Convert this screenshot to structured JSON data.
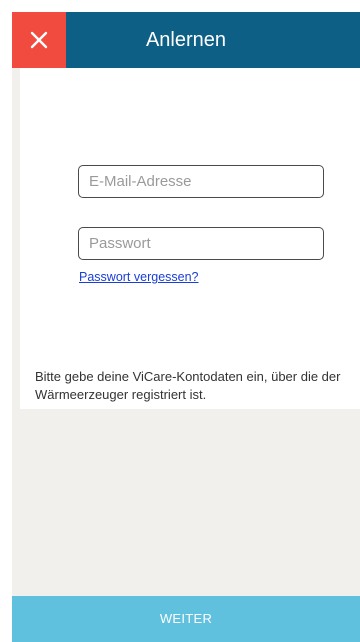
{
  "header": {
    "title": "Anlernen",
    "close_icon": "close-icon"
  },
  "login": {
    "email_placeholder": "E-Mail-Adresse",
    "email_value": "",
    "password_placeholder": "Passwort",
    "password_value": "",
    "forgot_password_label": "Passwort vergessen?",
    "info_text": "Bitte gebe deine ViCare-Kontodaten ein, über die der Wärmeerzeuger registriert ist."
  },
  "footer": {
    "continue_label": "WEITER"
  },
  "colors": {
    "header_bg": "#0e5f86",
    "close_bg": "#f04b3e",
    "content_bg": "#f1f0ec",
    "button_bg": "#5fc1de",
    "link": "#1a3fd6"
  }
}
